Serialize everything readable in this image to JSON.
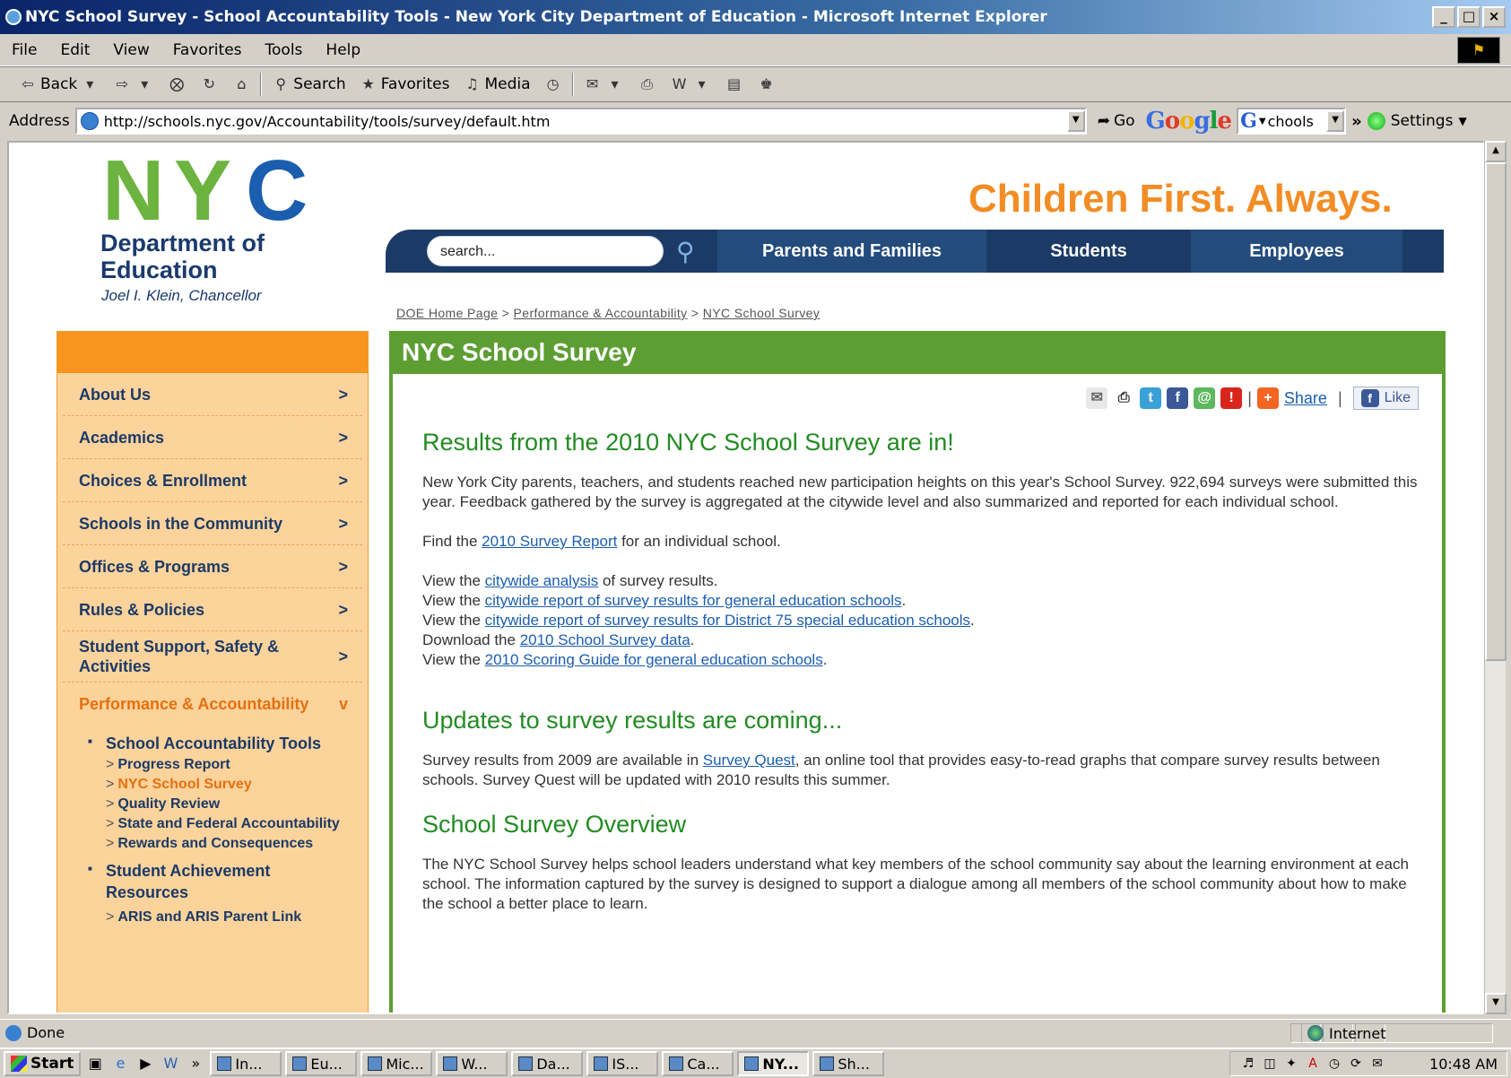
{
  "window": {
    "title": "NYC School Survey - School Accountability Tools - New York City Department of Education - Microsoft Internet Explorer",
    "controls": {
      "minimize": "_",
      "maximize": "□",
      "close": "×"
    }
  },
  "menu": [
    "File",
    "Edit",
    "View",
    "Favorites",
    "Tools",
    "Help"
  ],
  "toolbar": {
    "back": "Back",
    "search": "Search",
    "favorites": "Favorites",
    "media": "Media"
  },
  "address": {
    "label": "Address",
    "url": "http://schools.nyc.gov/Accountability/tools/survey/default.htm",
    "go": "Go"
  },
  "google": {
    "logo": "Google",
    "field_value": "chools",
    "settings": "Settings"
  },
  "page": {
    "logo_letters": [
      "N",
      "Y",
      "C"
    ],
    "dept_name": "Department of Education",
    "chancellor": "Joel I. Klein, Chancellor",
    "tagline": "Children First. Always.",
    "search_placeholder": "search...",
    "nav": [
      "Parents and Families",
      "Students",
      "Employees"
    ],
    "breadcrumb": [
      "DOE Home Page",
      "Performance & Accountability",
      "NYC School Survey"
    ],
    "sidebar": {
      "items": [
        "About Us",
        "Academics",
        "Choices & Enrollment",
        "Schools in the Community",
        "Offices & Programs",
        "Rules & Policies",
        "Student Support, Safety & Activities"
      ],
      "active": "Performance & Accountability",
      "chevron": ">",
      "active_chevron": "v",
      "sub1": "School Accountability Tools",
      "sub1_items": [
        "Progress Report",
        "NYC School Survey",
        "Quality Review",
        "State and Federal Accountability",
        "Rewards and Consequences"
      ],
      "sub2": "Student Achievement Resources",
      "sub2_items": [
        "ARIS and ARIS Parent Link"
      ]
    },
    "main": {
      "heading": "NYC School Survey",
      "share": "Share",
      "like": "Like",
      "h1": "Results from the 2010 NYC School Survey are in!",
      "p1": "New York City parents, teachers, and students reached new participation heights on this year's School Survey. 922,694 surveys were submitted this year. Feedback gathered by the survey is aggregated at the citywide level and also summarized and reported for each individual school.",
      "p2_pre": "Find the ",
      "p2_link": "2010 Survey Report",
      "p2_post": " for an individual school.",
      "l1_pre": "View the ",
      "l1_link": "citywide analysis",
      "l1_post": " of survey results.",
      "l2_pre": "View the ",
      "l2_link": "citywide report of survey results for general education schools",
      "l2_post": ".",
      "l3_pre": "View the ",
      "l3_link": "citywide report of survey results for District 75 special education schools",
      "l3_post": ".",
      "l4_pre": "Download the ",
      "l4_link": "2010 School Survey data",
      "l4_post": ".",
      "l5_pre": "View the ",
      "l5_link": "2010 Scoring Guide for general education schools",
      "l5_post": ".",
      "h2": "Updates to survey results are coming...",
      "p3_pre": "Survey results from 2009 are available in ",
      "p3_link": "Survey Quest",
      "p3_post": ", an online tool that provides easy-to-read graphs that compare survey results between schools. Survey Quest will be updated with 2010 results this summer.",
      "h3": "School Survey Overview",
      "p4": "The NYC School Survey helps school leaders understand what key members of the school community say about the learning environment at each school. The information captured by the survey is designed to support a dialogue among all members of the school community about how to make the school a better place to learn."
    }
  },
  "status": {
    "text": "Done",
    "zone": "Internet"
  },
  "taskbar": {
    "start": "Start",
    "tasks": [
      "In...",
      "Eu...",
      "Mic...",
      "W...",
      "Da...",
      "IS...",
      "Ca...",
      "NY...",
      "Sh..."
    ],
    "active_index": 7,
    "clock": "10:48 AM"
  },
  "colors": {
    "orange": "#f28c24",
    "navy": "#1b3a66",
    "green": "#5d9e33",
    "link": "#1b5eaf"
  }
}
